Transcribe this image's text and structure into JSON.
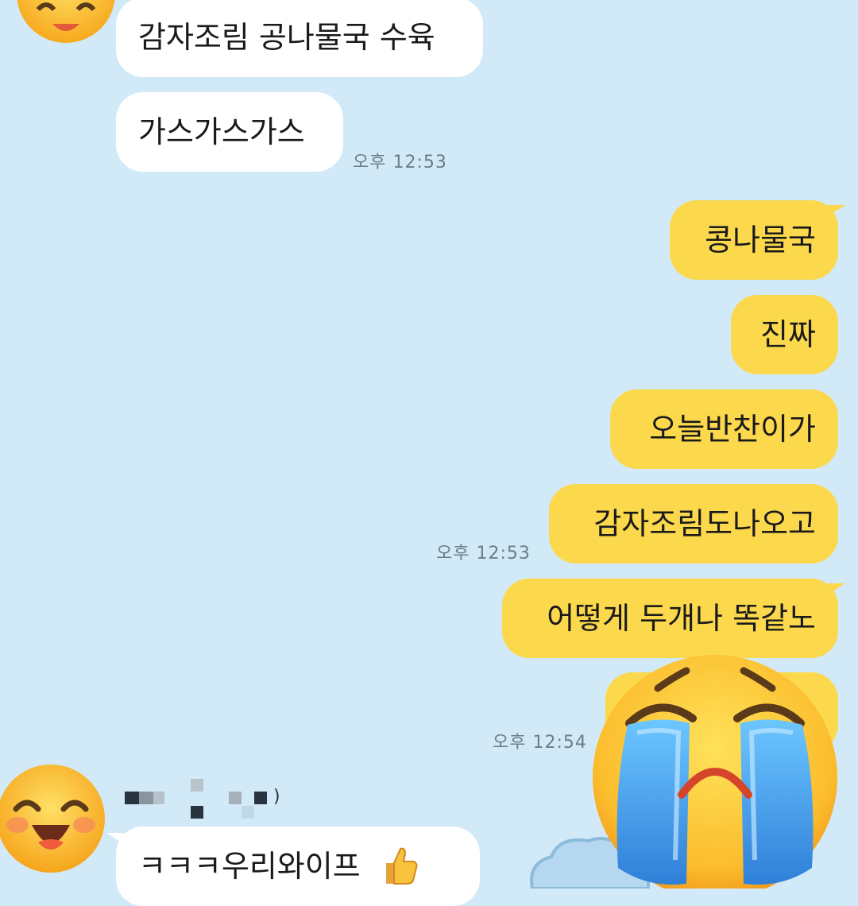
{
  "messages": [
    {
      "id": "in-1",
      "side": "in",
      "text": "감자조림 공나물국 수육"
    },
    {
      "id": "in-2",
      "side": "in",
      "text": "가스가스가스"
    },
    {
      "id": "out-1",
      "side": "out",
      "text": "콩나물국"
    },
    {
      "id": "out-2",
      "side": "out",
      "text": "진짜"
    },
    {
      "id": "out-3",
      "side": "out",
      "text": "오늘반찬이가"
    },
    {
      "id": "out-4",
      "side": "out",
      "text": "감자조림도나오고"
    },
    {
      "id": "out-5",
      "side": "out",
      "text": "어떻게 두개나 똑같노"
    },
    {
      "id": "out-6",
      "side": "out",
      "text": ""
    },
    {
      "id": "in-3",
      "side": "in",
      "text": "ㅋㅋㅋ우리와이프"
    }
  ],
  "timestamps": {
    "t1": "오후 12:53",
    "t2": "오후 12:53",
    "t3": "오후 12:54"
  },
  "sender_name_suffix": ")",
  "icons": {
    "top_avatar": "grinning-face-icon",
    "bottom_avatar": "laughing-face-icon",
    "crying": "loudly-crying-face-icon",
    "thumb": "thumbs-up-icon",
    "cloud": "cloud-icon"
  },
  "colors": {
    "background": "#d2eaf8",
    "incoming_bubble": "#ffffff",
    "outgoing_bubble": "#fbd84c",
    "timestamp": "#6d7c87",
    "emoji_yellow": "#fcc53a",
    "tear_blue": "#4aa8ee"
  }
}
